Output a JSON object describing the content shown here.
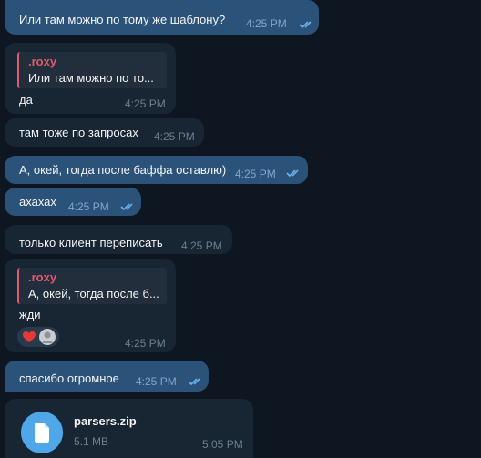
{
  "colors": {
    "background": "#0e1621",
    "outgoing_bubble": "#2b5278",
    "incoming_bubble": "#182533",
    "reply_accent": "#e05a6a",
    "file_icon": "#4fa7e9",
    "read_check": "#6ab2f2"
  },
  "messages": [
    {
      "text": "Или там можно по тому же шаблону?",
      "time": "4:25 PM",
      "direction": "outgoing",
      "read": true
    },
    {
      "reply_name": ".roxy",
      "reply_text": "Или там можно по то...",
      "text": "да",
      "time": "4:25 PM",
      "direction": "incoming"
    },
    {
      "text": "там тоже по запросах",
      "time": "4:25 PM",
      "direction": "incoming"
    },
    {
      "text": "А, окей, тогда после баффа оставлю)",
      "time": "4:25 PM",
      "direction": "outgoing",
      "read": true
    },
    {
      "text": "ахахах",
      "time": "4:25 PM",
      "direction": "outgoing",
      "read": true
    },
    {
      "text": "только клиент переписать",
      "time": "4:25 PM",
      "direction": "incoming"
    },
    {
      "reply_name": ".roxy",
      "reply_text": "А, окей, тогда после б...",
      "text": "жди",
      "time": "4:25 PM",
      "direction": "incoming",
      "reactions": [
        "heart-emoji",
        "avatar"
      ]
    },
    {
      "text": "спасибо огромное",
      "time": "4:25 PM",
      "direction": "outgoing",
      "read": true
    },
    {
      "file_name": "parsers.zip",
      "file_size": "5.1 MB",
      "time": "5:05 PM",
      "direction": "incoming",
      "icon": "file-icon"
    }
  ]
}
